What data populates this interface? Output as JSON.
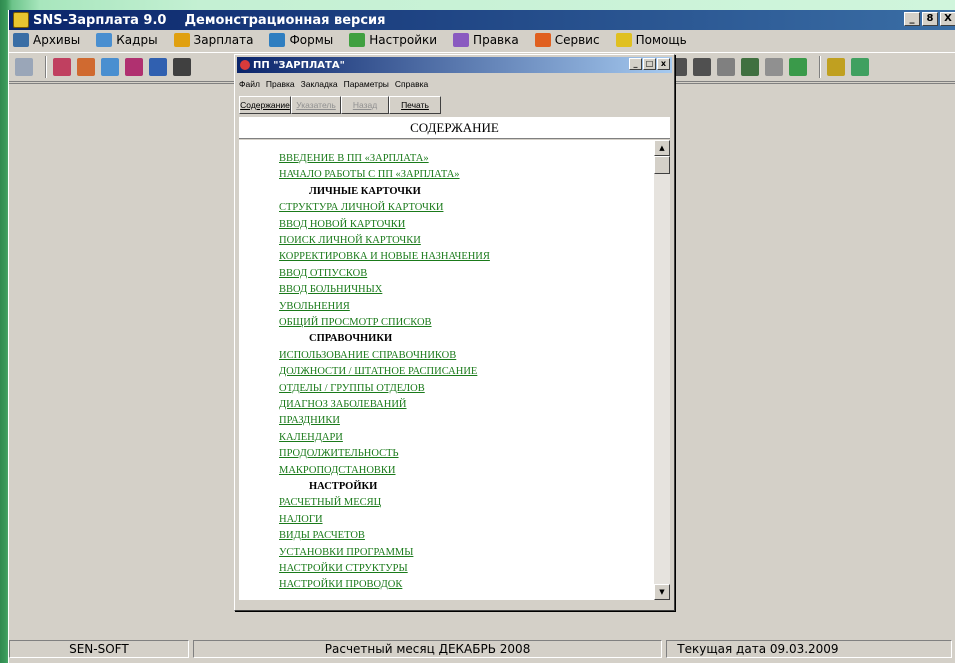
{
  "app": {
    "title": "SNS-Зарплата 9.0",
    "subtitle": "Демонстрационная версия",
    "window_buttons": [
      "_",
      "8",
      "X"
    ]
  },
  "menu": [
    {
      "label": "Архивы",
      "icon": "archive-icon",
      "color": "#3a6ea5"
    },
    {
      "label": "Кадры",
      "icon": "staff-icon",
      "color": "#4a8fd0"
    },
    {
      "label": "Зарплата",
      "icon": "salary-icon",
      "color": "#e0a010"
    },
    {
      "label": "Формы",
      "icon": "forms-icon",
      "color": "#2f7ec0"
    },
    {
      "label": "Настройки",
      "icon": "settings-icon",
      "color": "#40a040"
    },
    {
      "label": "Правка",
      "icon": "edit-icon",
      "color": "#8a5ac0"
    },
    {
      "label": "Сервис",
      "icon": "service-icon",
      "color": "#e06020"
    },
    {
      "label": "Помощь",
      "icon": "help-icon",
      "color": "#e0c020"
    }
  ],
  "help": {
    "title": "ПП \"ЗАРПЛАТА\"",
    "window_buttons": [
      "_",
      "□",
      "x"
    ],
    "menu": [
      "Файл",
      "Правка",
      "Закладка",
      "Параметры",
      "Справка"
    ],
    "buttons": [
      {
        "label": "Содержание",
        "enabled": true
      },
      {
        "label": "Указатель",
        "enabled": false
      },
      {
        "label": "Назад",
        "enabled": false
      },
      {
        "label": "Печать",
        "enabled": true
      }
    ],
    "heading": "СОДЕРЖАНИЕ",
    "toc": [
      {
        "text": "ВВЕДЕНИЕ В ПП «ЗАРПЛАТА»",
        "type": "link"
      },
      {
        "text": "НАЧАЛО РАБОТЫ С ПП «ЗАРПЛАТА»",
        "type": "link"
      },
      {
        "text": "ЛИЧНЫЕ КАРТОЧКИ",
        "type": "heading"
      },
      {
        "text": "СТРУКТУРА ЛИЧНОЙ КАРТОЧКИ",
        "type": "link"
      },
      {
        "text": "ВВОД НОВОЙ КАРТОЧКИ",
        "type": "link"
      },
      {
        "text": "ПОИСК ЛИЧНОЙ КАРТОЧКИ",
        "type": "link"
      },
      {
        "text": "КОРРЕКТИРОВКА И НОВЫЕ НАЗНАЧЕНИЯ",
        "type": "link"
      },
      {
        "text": "ВВОД ОТПУСКОВ",
        "type": "link"
      },
      {
        "text": "ВВОД БОЛЬНИЧНЫХ",
        "type": "link"
      },
      {
        "text": "УВОЛЬНЕНИЯ",
        "type": "link"
      },
      {
        "text": "ОБЩИЙ ПРОСМОТР СПИСКОВ",
        "type": "link"
      },
      {
        "text": "СПРАВОЧНИКИ",
        "type": "heading"
      },
      {
        "text": "ИСПОЛЬЗОВАНИЕ СПРАВОЧНИКОВ",
        "type": "link"
      },
      {
        "text": "ДОЛЖНОСТИ / ШТАТНОЕ РАСПИСАНИЕ",
        "type": "link"
      },
      {
        "text": "ОТДЕЛЫ / ГРУППЫ ОТДЕЛОВ",
        "type": "link"
      },
      {
        "text": "ДИАГНОЗ ЗАБОЛЕВАНИЙ",
        "type": "link"
      },
      {
        "text": "ПРАЗДНИКИ",
        "type": "link"
      },
      {
        "text": "КАЛЕНДАРИ",
        "type": "link"
      },
      {
        "text": "ПРОДОЛЖИТЕЛЬНОСТЬ",
        "type": "link"
      },
      {
        "text": "МАКРОПОДСТАНОВКИ",
        "type": "link"
      },
      {
        "text": "НАСТРОЙКИ",
        "type": "heading"
      },
      {
        "text": "РАСЧЕТНЫЙ МЕСЯЦ",
        "type": "link"
      },
      {
        "text": "НАЛОГИ",
        "type": "link"
      },
      {
        "text": "ВИДЫ РАСЧЕТОВ",
        "type": "link"
      },
      {
        "text": "УСТАНОВКИ ПРОГРАММЫ",
        "type": "link"
      },
      {
        "text": "НАСТРОЙКИ СТРУКТУРЫ",
        "type": "link"
      },
      {
        "text": "НАСТРОЙКИ ПРОВОДОК",
        "type": "link"
      }
    ]
  },
  "status": {
    "company": "SEN-SOFT",
    "month": "Расчетный месяц   ДЕКАБРЬ 2008",
    "date": "Текущая дата   09.03.2009"
  }
}
